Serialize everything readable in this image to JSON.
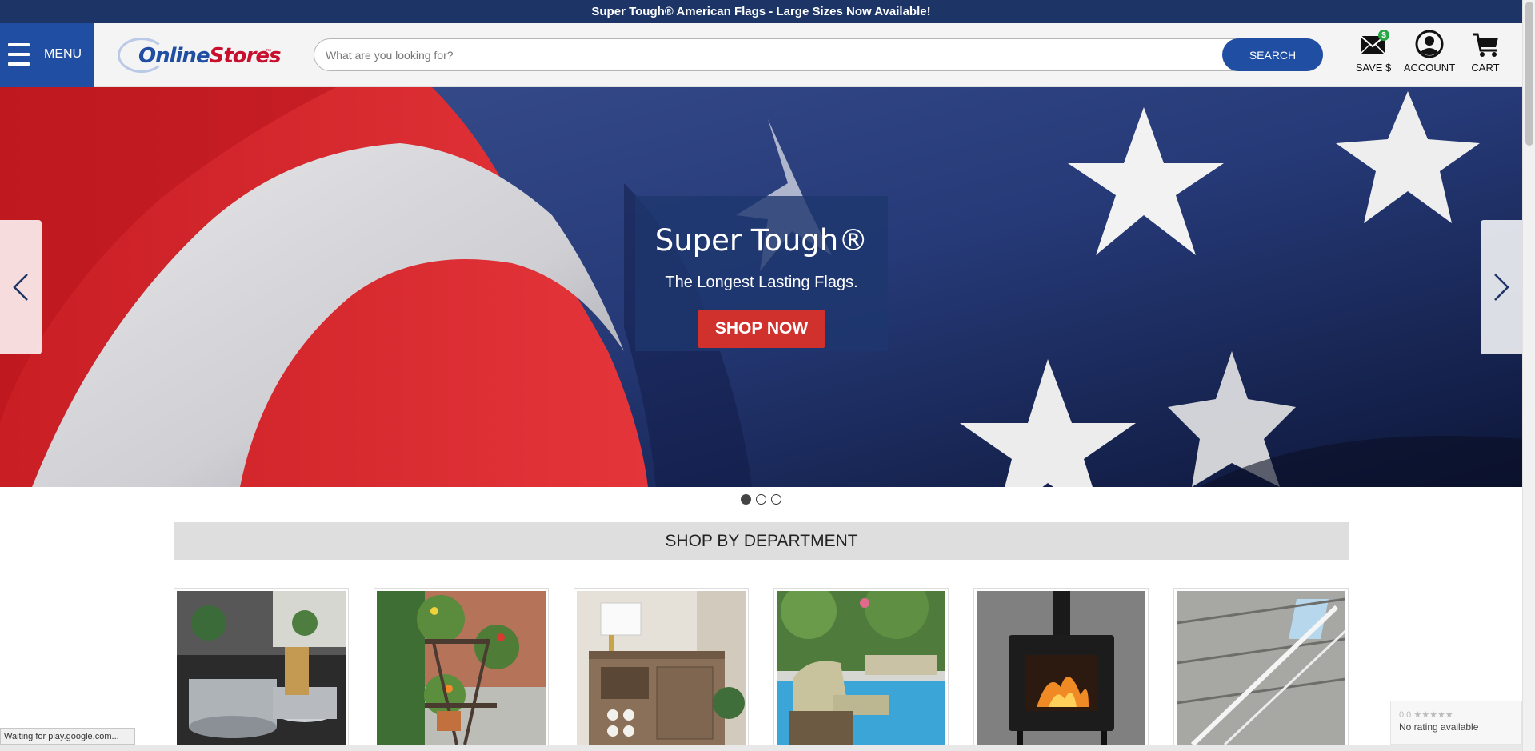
{
  "promo": {
    "text": "Super Tough® American Flags - Large Sizes Now Available!"
  },
  "header": {
    "menu_label": "MENU",
    "logo_online": "Online",
    "logo_stores": "Stores",
    "logo_tm": "™",
    "search_placeholder": "What are you looking for?",
    "search_value": "",
    "search_button": "SEARCH",
    "save_label": "SAVE $",
    "save_badge": "$",
    "account_label": "ACCOUNT",
    "cart_label": "CART"
  },
  "hero": {
    "title": "Super Tough®",
    "subtitle": "The Longest Lasting Flags.",
    "cta": "SHOP NOW",
    "slide_count": 3,
    "active_slide": 1
  },
  "departments": {
    "heading": "SHOP BY DEPARTMENT",
    "items": [
      {
        "icon": "cookware-photo"
      },
      {
        "icon": "garden-plant-stand-photo"
      },
      {
        "icon": "wood-cabinet-photo"
      },
      {
        "icon": "patio-chair-pool-photo"
      },
      {
        "icon": "wood-stove-photo"
      },
      {
        "icon": "warehouse-ceiling-photo"
      }
    ]
  },
  "status_bar": {
    "text": "Waiting for play.google.com..."
  },
  "rating_widget": {
    "score": "0.0",
    "stars": "★★★★★",
    "text": "No rating available"
  },
  "colors": {
    "navy": "#1c3566",
    "brand_blue": "#1f4ea3",
    "cta_red": "#d0312d"
  }
}
